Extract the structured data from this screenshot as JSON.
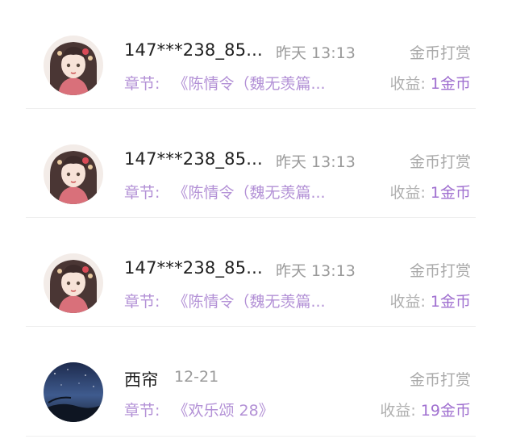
{
  "tips": [
    {
      "username": "147***238_85...",
      "time": "昨天 13:13",
      "type": "金币打赏",
      "chapter_label": "章节:",
      "chapter": "《陈情令（魏无羡篇...",
      "income_label": "收益:",
      "income_value": "1金币",
      "avatar": "anime-girl-avatar"
    },
    {
      "username": "147***238_85...",
      "time": "昨天 13:13",
      "type": "金币打赏",
      "chapter_label": "章节:",
      "chapter": "《陈情令（魏无羡篇...",
      "income_label": "收益:",
      "income_value": "1金币",
      "avatar": "anime-girl-avatar"
    },
    {
      "username": "147***238_85...",
      "time": "昨天 13:13",
      "type": "金币打赏",
      "chapter_label": "章节:",
      "chapter": "《陈情令（魏无羡篇...",
      "income_label": "收益:",
      "income_value": "1金币",
      "avatar": "anime-girl-avatar"
    },
    {
      "username": "西帘",
      "time": "12-21",
      "type": "金币打赏",
      "chapter_label": "章节:",
      "chapter": "《欢乐颂 28》",
      "income_label": "收益:",
      "income_value": "19金币",
      "avatar": "night-sky-avatar"
    }
  ],
  "colors": {
    "accent_purple": "#b391d6",
    "income_purple": "#a070d0",
    "muted_gray": "#a9a9a9",
    "text_dark": "#1f1f1f"
  }
}
